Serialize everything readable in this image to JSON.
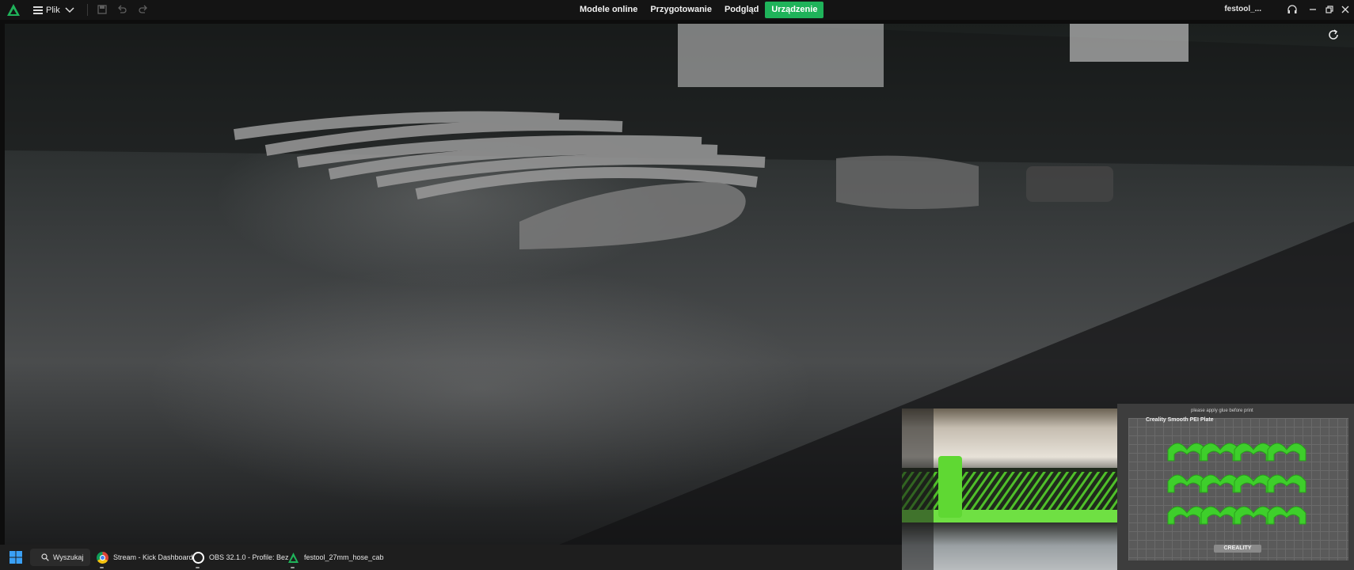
{
  "app": {
    "menu_label": "Plik",
    "project_name": "festool_..."
  },
  "tabs": [
    {
      "label": "Modele online",
      "active": false
    },
    {
      "label": "Przygotowanie",
      "active": false
    },
    {
      "label": "Podgląd",
      "active": false
    },
    {
      "label": "Urządzenie",
      "active": true
    }
  ],
  "overlay": {
    "plate_name": "Creality Smooth PEI Plate",
    "plate_note": "please apply glue before print",
    "brand": "CREALITY"
  },
  "taskbar": {
    "search_label": "Wyszukaj",
    "items": [
      {
        "label": "Stream - Kick Dashboard",
        "icon": "chrome-icon"
      },
      {
        "label": "OBS 32.1.0 - Profile: Bez",
        "icon": "obs-icon"
      },
      {
        "label": "festool_27mm_hose_cab",
        "icon": "creality-print-icon"
      }
    ]
  },
  "colors": {
    "accent": "#1fb35a",
    "titlebar_bg": "#141414",
    "taskbar_bg": "#1e1e1e",
    "part_green": "#3ecf2b"
  }
}
